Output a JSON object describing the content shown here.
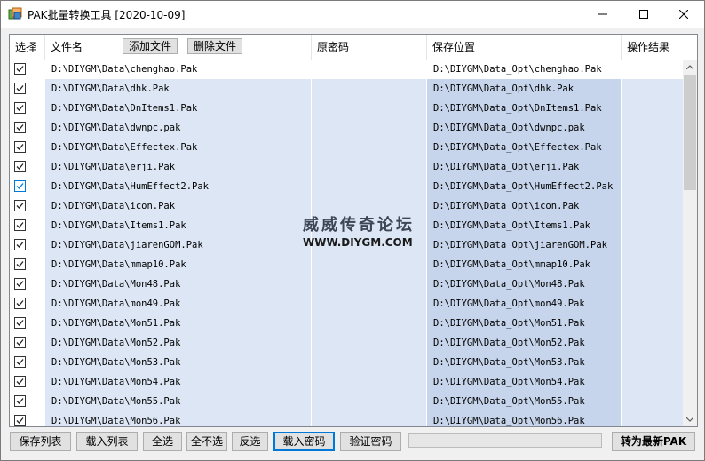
{
  "window": {
    "title": "PAK批量转换工具 [2020-10-09]"
  },
  "columns": {
    "select": "选择",
    "filename": "文件名",
    "add_files": "添加文件",
    "delete_files": "删除文件",
    "original_password": "原密码",
    "save_location": "保存位置",
    "result": "操作结果"
  },
  "rows": [
    {
      "checked": true,
      "file": "D:\\DIYGM\\Data\\chenghao.Pak",
      "password": "",
      "save": "D:\\DIYGM\\Data_Opt\\chenghao.Pak",
      "result": "",
      "selected": false
    },
    {
      "checked": true,
      "file": "D:\\DIYGM\\Data\\dhk.Pak",
      "password": "",
      "save": "D:\\DIYGM\\Data_Opt\\dhk.Pak",
      "result": "",
      "selected": true
    },
    {
      "checked": true,
      "file": "D:\\DIYGM\\Data\\DnItems1.Pak",
      "password": "",
      "save": "D:\\DIYGM\\Data_Opt\\DnItems1.Pak",
      "result": "",
      "selected": true
    },
    {
      "checked": true,
      "file": "D:\\DIYGM\\Data\\dwnpc.pak",
      "password": "",
      "save": "D:\\DIYGM\\Data_Opt\\dwnpc.pak",
      "result": "",
      "selected": true
    },
    {
      "checked": true,
      "file": "D:\\DIYGM\\Data\\Effectex.Pak",
      "password": "",
      "save": "D:\\DIYGM\\Data_Opt\\Effectex.Pak",
      "result": "",
      "selected": true
    },
    {
      "checked": true,
      "file": "D:\\DIYGM\\Data\\erji.Pak",
      "password": "",
      "save": "D:\\DIYGM\\Data_Opt\\erji.Pak",
      "result": "",
      "selected": true
    },
    {
      "checked": true,
      "file": "D:\\DIYGM\\Data\\HumEffect2.Pak",
      "password": "",
      "save": "D:\\DIYGM\\Data_Opt\\HumEffect2.Pak",
      "result": "",
      "selected": true
    },
    {
      "checked": true,
      "file": "D:\\DIYGM\\Data\\icon.Pak",
      "password": "",
      "save": "D:\\DIYGM\\Data_Opt\\icon.Pak",
      "result": "",
      "selected": true
    },
    {
      "checked": true,
      "file": "D:\\DIYGM\\Data\\Items1.Pak",
      "password": "",
      "save": "D:\\DIYGM\\Data_Opt\\Items1.Pak",
      "result": "",
      "selected": true
    },
    {
      "checked": true,
      "file": "D:\\DIYGM\\Data\\jiarenGOM.Pak",
      "password": "",
      "save": "D:\\DIYGM\\Data_Opt\\jiarenGOM.Pak",
      "result": "",
      "selected": true
    },
    {
      "checked": true,
      "file": "D:\\DIYGM\\Data\\mmap10.Pak",
      "password": "",
      "save": "D:\\DIYGM\\Data_Opt\\mmap10.Pak",
      "result": "",
      "selected": true
    },
    {
      "checked": true,
      "file": "D:\\DIYGM\\Data\\Mon48.Pak",
      "password": "",
      "save": "D:\\DIYGM\\Data_Opt\\Mon48.Pak",
      "result": "",
      "selected": true
    },
    {
      "checked": true,
      "file": "D:\\DIYGM\\Data\\mon49.Pak",
      "password": "",
      "save": "D:\\DIYGM\\Data_Opt\\mon49.Pak",
      "result": "",
      "selected": true
    },
    {
      "checked": true,
      "file": "D:\\DIYGM\\Data\\Mon51.Pak",
      "password": "",
      "save": "D:\\DIYGM\\Data_Opt\\Mon51.Pak",
      "result": "",
      "selected": true
    },
    {
      "checked": true,
      "file": "D:\\DIYGM\\Data\\Mon52.Pak",
      "password": "",
      "save": "D:\\DIYGM\\Data_Opt\\Mon52.Pak",
      "result": "",
      "selected": true
    },
    {
      "checked": true,
      "file": "D:\\DIYGM\\Data\\Mon53.Pak",
      "password": "",
      "save": "D:\\DIYGM\\Data_Opt\\Mon53.Pak",
      "result": "",
      "selected": true
    },
    {
      "checked": true,
      "file": "D:\\DIYGM\\Data\\Mon54.Pak",
      "password": "",
      "save": "D:\\DIYGM\\Data_Opt\\Mon54.Pak",
      "result": "",
      "selected": true
    },
    {
      "checked": true,
      "file": "D:\\DIYGM\\Data\\Mon55.Pak",
      "password": "",
      "save": "D:\\DIYGM\\Data_Opt\\Mon55.Pak",
      "result": "",
      "selected": true
    },
    {
      "checked": true,
      "file": "D:\\DIYGM\\Data\\Mon56.Pak",
      "password": "",
      "save": "D:\\DIYGM\\Data_Opt\\Mon56.Pak",
      "result": "",
      "selected": true
    }
  ],
  "watermark": {
    "line1": "威威传奇论坛",
    "line2": "WWW.DIYGM.COM"
  },
  "toolbar": {
    "save_list": "保存列表",
    "load_list": "载入列表",
    "select_all": "全选",
    "select_none": "全不选",
    "invert": "反选",
    "load_password": "载入密码",
    "verify_password": "验证密码",
    "convert": "转为最新PAK",
    "progress": 0
  },
  "colors": {
    "selected_row": "#dce6f4",
    "selected_save_col": "#c6d5ec",
    "accent": "#0078d7"
  },
  "icons": {
    "app": "app-icon",
    "minimize": "minimize-icon",
    "maximize": "maximize-icon",
    "close": "close-icon",
    "check": "checkmark-icon",
    "scroll_up": "scroll-up-arrow-icon",
    "scroll_down": "scroll-down-arrow-icon"
  }
}
